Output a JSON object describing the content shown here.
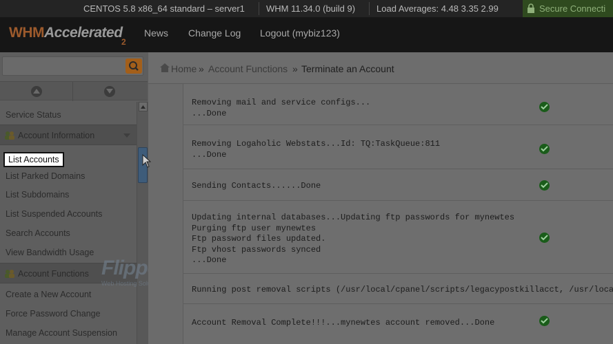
{
  "statusbar": {
    "os": "CENTOS 5.8 x86_64 standard – server1",
    "whm_version": "WHM 11.34.0 (build 9)",
    "load_averages": "Load Averages: 4.48 3.35 2.99",
    "secure": "Secure Connecti"
  },
  "header": {
    "logo_whm": "WHM",
    "logo_accelerated": "Accelerated",
    "logo_two": "2",
    "nav": [
      "News",
      "Change Log",
      "Logout (mybiz123)"
    ]
  },
  "sidebar": {
    "search_placeholder": "",
    "items_top": [
      "Service Status"
    ],
    "section_account_info": "Account Information",
    "account_info_items": [
      "List Accounts",
      "List Parked Domains",
      "List Subdomains",
      "List Suspended Accounts",
      "Search Accounts",
      "View Bandwidth Usage"
    ],
    "section_account_functions": "Account Functions",
    "account_functions_items": [
      "Create a New Account",
      "Force Password Change",
      "Manage Account Suspension"
    ]
  },
  "breadcrumb": {
    "home": "Home",
    "sep": "»",
    "parent": "Account Functions",
    "current": "Terminate an Account"
  },
  "log_rows": [
    {
      "text": "Removing mail and service configs...\n...Done",
      "done": true
    },
    {
      "text": "Removing Logaholic Webstats...Id: TQ:TaskQueue:811\n...Done",
      "done": true
    },
    {
      "text": "Sending Contacts......Done",
      "done": true
    },
    {
      "text": "Updating internal databases...Updating ftp passwords for mynewtes\nPurging ftp user mynewtes\nFtp password files updated.\nFtp vhost passwords synced\n...Done",
      "done": true
    },
    {
      "text": "Running post removal scripts (/usr/local/cpanel/scripts/legacypostkillacct, /usr/local/",
      "done": false
    },
    {
      "text": "Account Removal Complete!!!...mynewtes account removed...Done",
      "done": true
    }
  ],
  "watermark": {
    "brand": "FlipperHost",
    "tagline": "Web Hosting Solutions"
  },
  "colors": {
    "check_green": "#1a5c1a",
    "logo_orange": "#9c5a2c",
    "scroll_thumb": "#3e5c7a"
  }
}
